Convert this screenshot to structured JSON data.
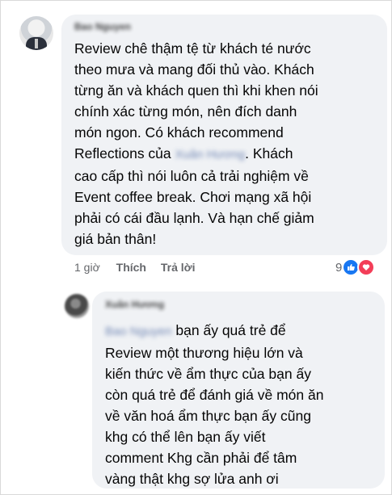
{
  "comment_main": {
    "author": "Bao Nguyen",
    "lines": [
      "Review chê thậm tệ từ khách té nước",
      "theo mưa và mang đối thủ vào. Khách",
      "từng ăn và khách quen thì khi khen nói",
      "chính xác từng món, nên đích danh",
      "món ngon. Có khách recommend",
      "Reflections của",
      "Xuân Hương",
      ". Khách",
      "cao cấp thì nói luôn cả trải nghiệm về",
      "Event coffee break. Chơi mạng xã hội",
      "phải có cái đầu lạnh. Và hạn chế giảm",
      "giá bản thân!"
    ],
    "time": "1 giờ",
    "like_label": "Thích",
    "reply_label": "Trả lời",
    "reaction_count": "9",
    "reaction_icons": [
      "like-icon",
      "heart-icon"
    ]
  },
  "comment_reply": {
    "author": "Xuân Hương",
    "mention": "Bao Nguyen",
    "lines": [
      " bạn ấy quá trẻ để",
      "Review một thương hiệu lớn và",
      "kiến thức về ẩm thực của bạn ấy",
      "còn quá trẻ để đánh giá về món ăn",
      "về văn hoá ẩm thực bạn ấy cũng",
      "khg có thể lên bạn ấy viết",
      "comment Khg cần phải để tâm",
      "vàng thật khg sợ lửa anh ơi"
    ]
  },
  "colors": {
    "bubble": "#f0f2f5",
    "like": "#1877f2",
    "heart": "#f33e58",
    "meta_text": "#65676b"
  }
}
